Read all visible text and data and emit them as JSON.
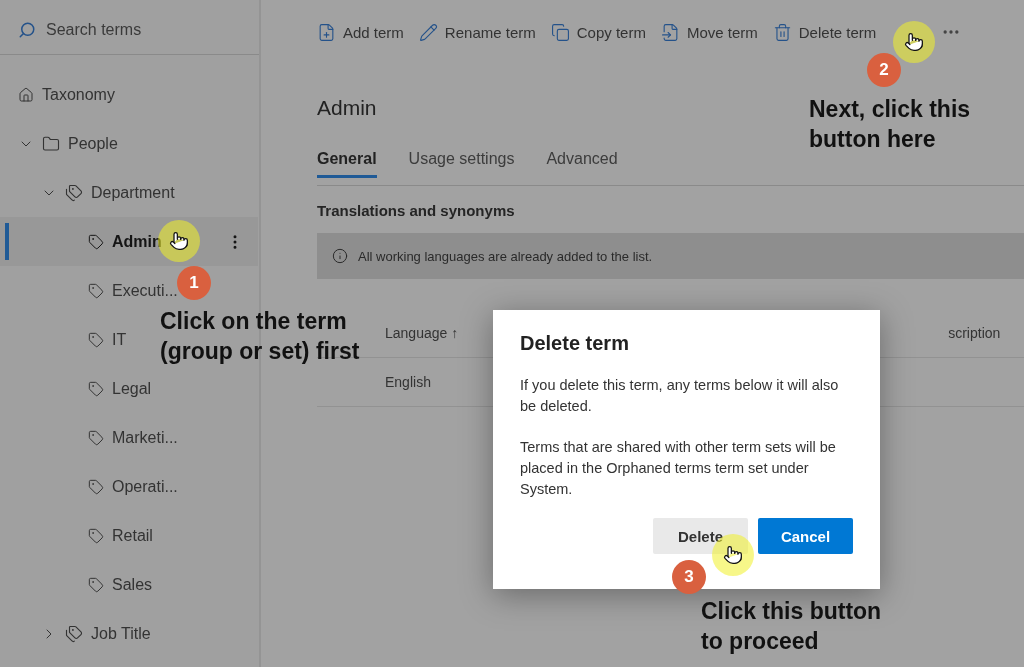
{
  "search": {
    "placeholder": "Search terms"
  },
  "tree": [
    {
      "label": "Taxonomy",
      "kind": "home",
      "selected": false
    },
    {
      "label": "People",
      "kind": "group",
      "selected": false,
      "expanded": true,
      "children": [
        {
          "label": "Department",
          "kind": "set",
          "selected": false,
          "expanded": true,
          "children": [
            {
              "label": "Admin",
              "kind": "term",
              "selected": true
            },
            {
              "label": "Executi...",
              "kind": "term",
              "selected": false
            },
            {
              "label": "IT",
              "kind": "term",
              "selected": false
            },
            {
              "label": "Legal",
              "kind": "term",
              "selected": false
            },
            {
              "label": "Marketi...",
              "kind": "term",
              "selected": false
            },
            {
              "label": "Operati...",
              "kind": "term",
              "selected": false
            },
            {
              "label": "Retail",
              "kind": "term",
              "selected": false
            },
            {
              "label": "Sales",
              "kind": "term",
              "selected": false
            }
          ]
        },
        {
          "label": "Job Title",
          "kind": "set",
          "selected": false,
          "expanded": false
        }
      ]
    }
  ],
  "toolbar": [
    {
      "label": "Add term",
      "kind": "add"
    },
    {
      "label": "Rename term",
      "kind": "rename"
    },
    {
      "label": "Copy term",
      "kind": "copy"
    },
    {
      "label": "Move term",
      "kind": "move"
    },
    {
      "label": "Delete term",
      "kind": "delete"
    }
  ],
  "heading": "Admin",
  "tabs": [
    {
      "label": "General",
      "selected": true
    },
    {
      "label": "Usage settings",
      "selected": false
    },
    {
      "label": "Advanced",
      "selected": false
    }
  ],
  "section_title": "Translations and synonyms",
  "info_message": "All working languages are already added to the list.",
  "table": {
    "columns": [
      "Language ↑",
      "scription"
    ],
    "rows": [
      [
        "English"
      ]
    ]
  },
  "dialog": {
    "title": "Delete term",
    "paragraphs": [
      "If you delete this term, any terms below it will also be deleted.",
      "Terms that are shared with other term sets will be placed in the Orphaned terms term set under System."
    ],
    "buttons": [
      {
        "label": "Delete",
        "kind": "secondary"
      },
      {
        "label": "Cancel",
        "kind": "primary"
      }
    ]
  },
  "annotations": [
    {
      "number": "1",
      "text": "Click on the term\n(group or set) first"
    },
    {
      "number": "2",
      "text": "Next, click this\nbutton here"
    },
    {
      "number": "3",
      "text": "Click this button\nto proceed"
    }
  ]
}
